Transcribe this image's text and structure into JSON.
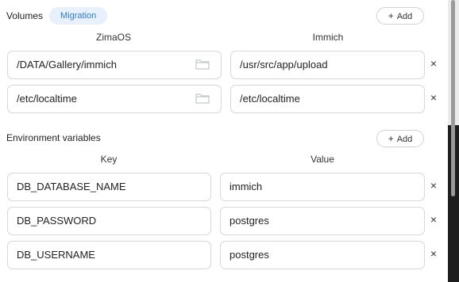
{
  "volumes": {
    "title": "Volumes",
    "badge": "Migration",
    "add_label": "Add",
    "col_left": "ZimaOS",
    "col_right": "Immich",
    "rows": [
      {
        "host": "/DATA/Gallery/immich",
        "container": "/usr/src/app/upload"
      },
      {
        "host": "/etc/localtime",
        "container": "/etc/localtime"
      }
    ]
  },
  "env": {
    "title": "Environment variables",
    "add_label": "Add",
    "col_left": "Key",
    "col_right": "Value",
    "rows": [
      {
        "key": "DB_DATABASE_NAME",
        "value": "immich"
      },
      {
        "key": "DB_PASSWORD",
        "value": "postgres"
      },
      {
        "key": "DB_USERNAME",
        "value": "postgres"
      }
    ]
  },
  "icons": {
    "plus": "plus-icon",
    "folder": "folder-icon",
    "remove": "close-icon"
  },
  "colors": {
    "badge_bg": "#e8f1fb",
    "badge_text": "#2f7bd0",
    "border": "#d4d7dc"
  }
}
